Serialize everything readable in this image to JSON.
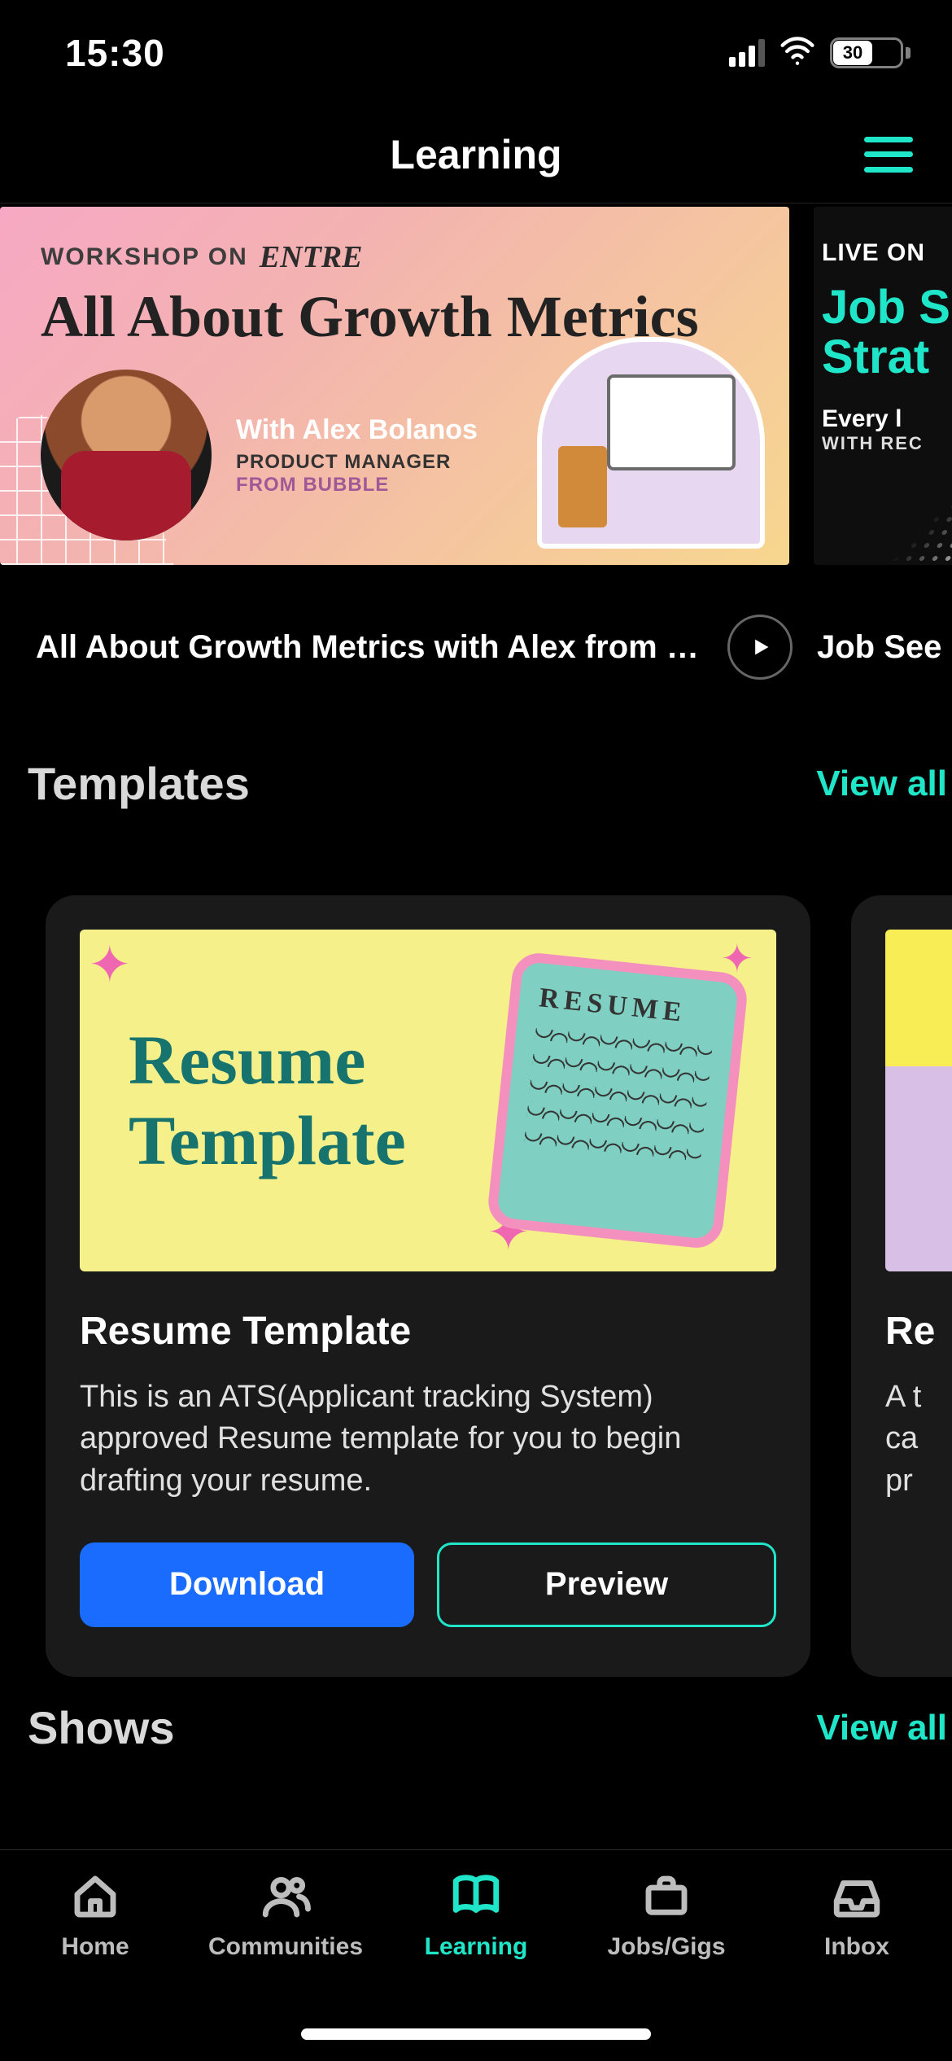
{
  "status": {
    "time": "15:30",
    "battery_pct": "30"
  },
  "header": {
    "title": "Learning"
  },
  "workshops": [
    {
      "eyebrow": "WORKSHOP ON",
      "brand": "ENTRE",
      "headline": "All About Growth Metrics",
      "presenter_with": "With Alex Bolanos",
      "presenter_role": "PRODUCT MANAGER",
      "presenter_from": "FROM BUBBLE",
      "row_title": "All About Growth Metrics with Alex from B..."
    },
    {
      "live_label": "LIVE ON",
      "title_line1": "Job S",
      "title_line2": "Strat",
      "schedule": "Every l",
      "schedule_sub": "WITH REC",
      "row_title": "Job See"
    }
  ],
  "sections": {
    "templates": {
      "title": "Templates",
      "view_all": "View all"
    },
    "shows": {
      "title": "Shows",
      "view_all": "View all"
    }
  },
  "templates": [
    {
      "thumb_text_line1": "Resume",
      "thumb_text_line2": "Template",
      "thumb_card_label": "RESUME",
      "title": "Resume Template",
      "desc": "This is an ATS(Applicant tracking System) approved Resume template for you to begin drafting your resume.",
      "primary_btn": "Download",
      "secondary_btn": "Preview"
    },
    {
      "title": "Re",
      "desc": "A t\nca\npr"
    }
  ],
  "tabs": {
    "home": "Home",
    "communities": "Communities",
    "learning": "Learning",
    "jobs": "Jobs/Gigs",
    "inbox": "Inbox"
  }
}
